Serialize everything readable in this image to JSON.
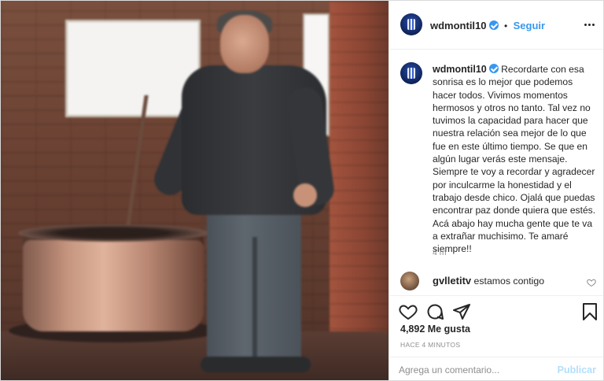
{
  "post": {
    "photo_alt": ""
  },
  "header": {
    "username": "wdmontil10",
    "separator": "•",
    "follow_label": "Seguir"
  },
  "caption": {
    "username": "wdmontil10",
    "text": "Recordarte con esa sonrisa es lo mejor que podemos hacer todos. Vivimos momentos hermosos y otros no tanto. Tal vez no tuvimos la capacidad para hacer que nuestra relación sea mejor de lo que fue en este último tiempo. Se que en algún lugar verás este mensaje. Siempre te voy a recordar y agradecer por inculcarme la honestidad y el trabajo desde chico. Ojalá que puedas encontrar paz donde quiera que estés. Acá abajo hay mucha gente que te va a extrañar muchisimo. Te amaré siempre!!",
    "time": "4 m"
  },
  "comments": [
    {
      "username": "gvlletitv",
      "text": "estamos contigo"
    }
  ],
  "actions": {
    "icons": [
      "heart-icon",
      "comment-icon",
      "share-icon",
      "bookmark-icon"
    ],
    "likes": "4,892 Me gusta",
    "posted": "HACE 4 MINUTOS"
  },
  "comment_box": {
    "placeholder": "Agrega un comentario...",
    "publish_label": "Publicar"
  },
  "colors": {
    "verified": "#3897f0",
    "link": "#3897f0",
    "publish_disabled": "#b2dffc",
    "text": "#262626",
    "muted": "#8e8e8e"
  }
}
